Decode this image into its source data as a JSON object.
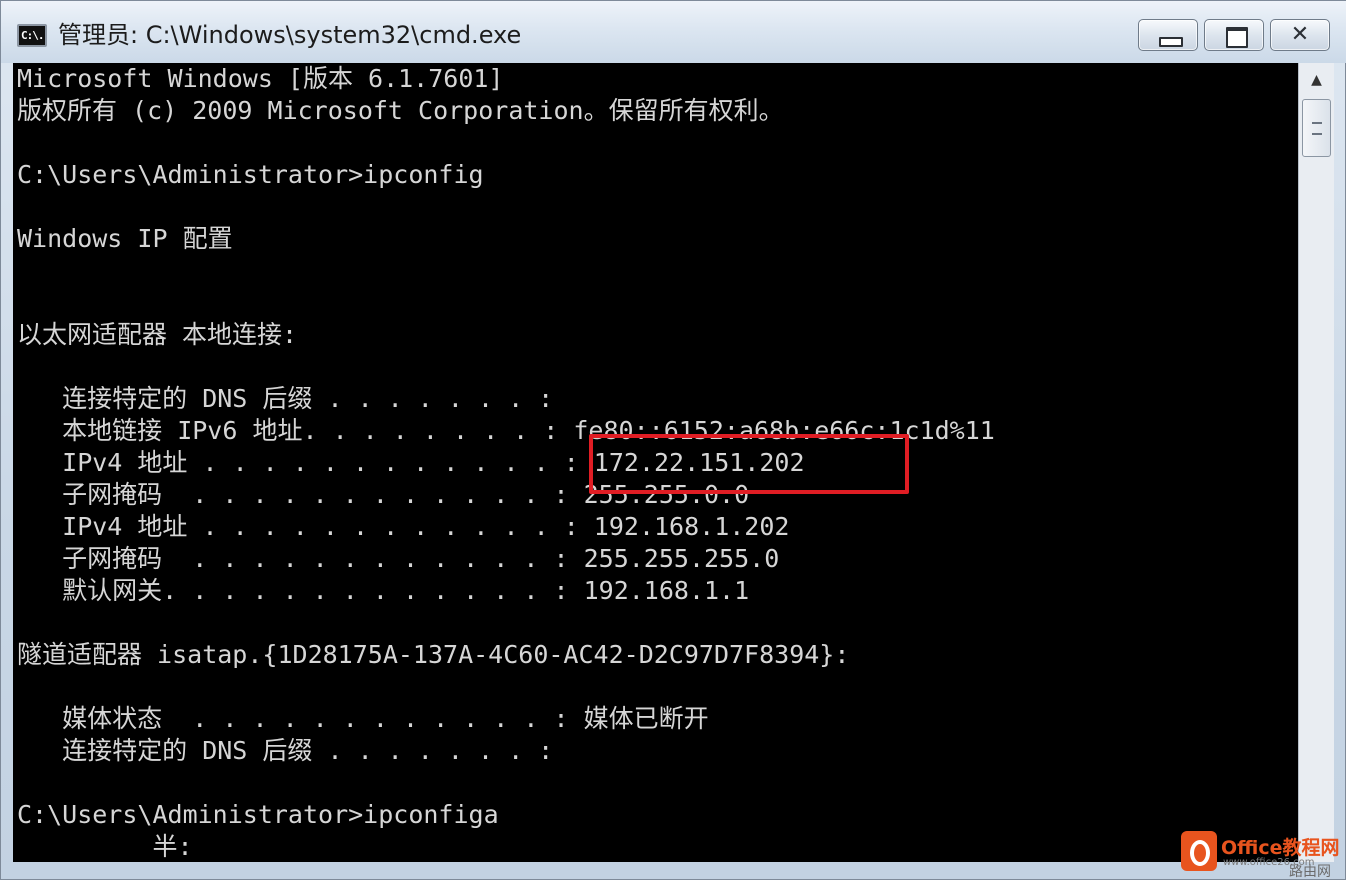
{
  "window": {
    "title": "管理员: C:\\Windows\\system32\\cmd.exe",
    "icon_label": "C:\\.",
    "controls": {
      "minimize": "minimize-icon",
      "maximize": "maximize-icon",
      "close": "✕"
    }
  },
  "console": {
    "lines": [
      "Microsoft Windows [版本 6.1.7601]",
      "版权所有 (c) 2009 Microsoft Corporation。保留所有权利。",
      "",
      "C:\\Users\\Administrator>ipconfig",
      "",
      "Windows IP 配置",
      "",
      "",
      "以太网适配器 本地连接:",
      "",
      "   连接特定的 DNS 后缀 . . . . . . . :",
      "   本地链接 IPv6 地址. . . . . . . . : fe80::6152:a68b:e66c:1c1d%11",
      "   IPv4 地址 . . . . . . . . . . . . : 172.22.151.202",
      "   子网掩码  . . . . . . . . . . . . : 255.255.0.0",
      "   IPv4 地址 . . . . . . . . . . . . : 192.168.1.202",
      "   子网掩码  . . . . . . . . . . . . : 255.255.255.0",
      "   默认网关. . . . . . . . . . . . . : 192.168.1.1",
      "",
      "隧道适配器 isatap.{1D28175A-137A-4C60-AC42-D2C97D7F8394}:",
      "",
      "   媒体状态  . . . . . . . . . . . . : 媒体已断开",
      "   连接特定的 DNS 后缀 . . . . . . . :",
      "",
      "C:\\Users\\Administrator>ipconfiga",
      "         半:"
    ],
    "highlight_color": "#e01d24"
  },
  "scrollbar": {
    "up_arrow": "▲"
  },
  "watermark": {
    "brand": "Office教程网",
    "url": "www.office26.com",
    "tail": "路由网"
  }
}
